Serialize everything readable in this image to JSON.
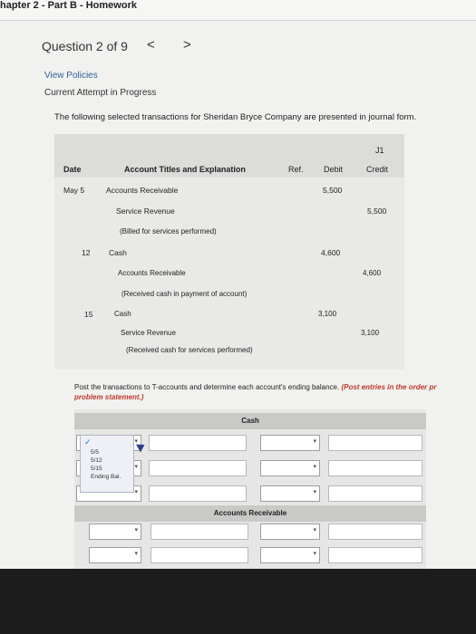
{
  "header": {
    "title": "hapter 2 - Part B - Homework"
  },
  "question": {
    "label": "Question 2 of 9",
    "prev_glyph": "<",
    "next_glyph": ">"
  },
  "links": {
    "view_policies": "View Policies"
  },
  "attempt": "Current Attempt in Progress",
  "intro": "The following selected transactions for Sheridan Bryce Company are presented in journal form.",
  "journal": {
    "page_ref": "J1",
    "columns": {
      "date": "Date",
      "account": "Account Titles and Explanation",
      "ref": "Ref.",
      "debit": "Debit",
      "credit": "Credit"
    },
    "rows": [
      {
        "date": "May 5",
        "account": "Accounts Receivable",
        "debit": "5,500",
        "credit": ""
      },
      {
        "date": "",
        "account": "Service Revenue",
        "debit": "",
        "credit": "5,500"
      },
      {
        "date": "",
        "account": "(Billed for services performed)",
        "debit": "",
        "credit": ""
      },
      {
        "date": "12",
        "account": "Cash",
        "debit": "4,600",
        "credit": ""
      },
      {
        "date": "",
        "account": "Accounts Receivable",
        "debit": "",
        "credit": "4,600"
      },
      {
        "date": "",
        "account": "(Received cash in payment of account)",
        "debit": "",
        "credit": ""
      },
      {
        "date": "15",
        "account": "Cash",
        "debit": "3,100",
        "credit": ""
      },
      {
        "date": "",
        "account": "Service Revenue",
        "debit": "",
        "credit": "3,100"
      },
      {
        "date": "",
        "account": "(Received cash for services performed)",
        "debit": "",
        "credit": ""
      }
    ]
  },
  "instructions": {
    "main": "Post the transactions to T-accounts and determine each account's ending balance.",
    "note": "(Post entries in the order pr",
    "note2": "problem statement.)"
  },
  "taccounts": {
    "cash_title": "Cash",
    "ar_title": "Accounts Receivable",
    "date_options": [
      "5/5",
      "5/12",
      "5/15",
      "Ending Bal."
    ],
    "checkmark": "✓"
  }
}
